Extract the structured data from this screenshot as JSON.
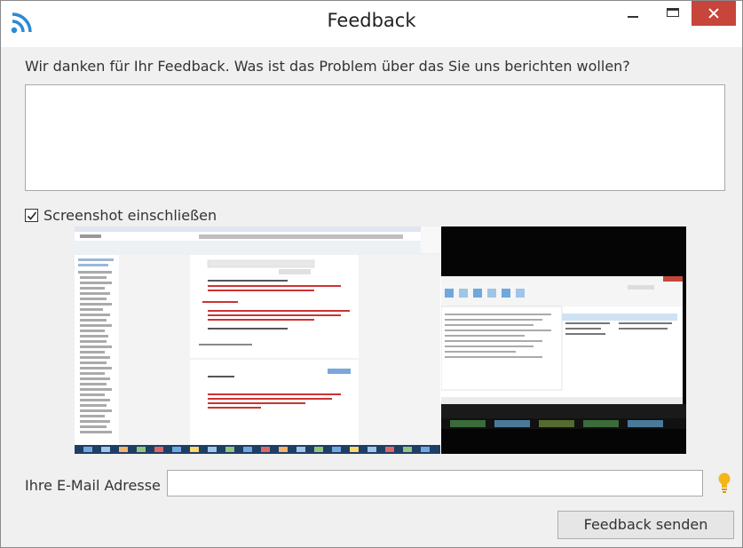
{
  "window": {
    "title": "Feedback",
    "icons": {
      "app": "rss-icon",
      "minimize": "minimize-icon",
      "maximize": "maximize-icon",
      "close": "close-icon"
    }
  },
  "form": {
    "question": "Wir danken für Ihr Feedback. Was ist das Problem über das Sie uns berichten wollen?",
    "feedback_value": "",
    "include_screenshot_label": "Screenshot einschließen",
    "include_screenshot_checked": true,
    "email_label": "Ihre E-Mail Adresse",
    "email_value": "",
    "email_hint_icon": "lightbulb-icon",
    "send_label": "Feedback senden"
  },
  "colors": {
    "accent_blue": "#2b8ad3",
    "close_red": "#c7453a",
    "bulb_yellow": "#f2b51c"
  }
}
